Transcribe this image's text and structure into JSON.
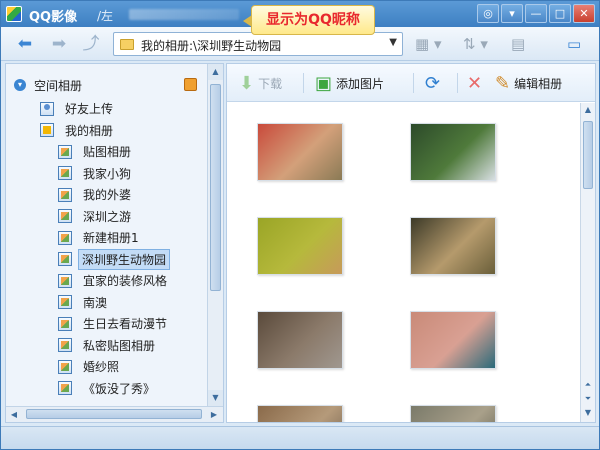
{
  "app": {
    "title": "QQ影像",
    "path_prefix": "/左"
  },
  "tooltip": "显示为QQ昵称",
  "address": {
    "value": "我的相册:\\深圳野生动物园"
  },
  "sidebar": {
    "title": "空间相册",
    "items": [
      {
        "label": "好友上传",
        "level": 1,
        "icon": "person"
      },
      {
        "label": "我的相册",
        "level": 1,
        "icon": "star"
      },
      {
        "label": "贴图相册",
        "level": 2
      },
      {
        "label": "我家小狗",
        "level": 2
      },
      {
        "label": "我的外婆",
        "level": 2
      },
      {
        "label": "深圳之游",
        "level": 2
      },
      {
        "label": "新建相册1",
        "level": 2
      },
      {
        "label": "深圳野生动物园",
        "level": 2,
        "selected": true
      },
      {
        "label": "宜家的装修风格",
        "level": 2
      },
      {
        "label": "南澳",
        "level": 2
      },
      {
        "label": "生日去看动漫节",
        "level": 2
      },
      {
        "label": "私密贴图相册",
        "level": 2
      },
      {
        "label": "婚纱照",
        "level": 2
      },
      {
        "label": "《饭没了秀》",
        "level": 2
      }
    ]
  },
  "toolbar": {
    "download": "下载",
    "add_picture": "添加图片",
    "edit_album": "编辑相册"
  },
  "photos": [
    {
      "name": "red-enclosure",
      "colors": [
        "#c94a3b",
        "#d3a07a",
        "#8a7a55"
      ]
    },
    {
      "name": "white-goat-fence",
      "colors": [
        "#2c4a2a",
        "#4f7a3b",
        "#d8dfe2"
      ]
    },
    {
      "name": "swimming-animal",
      "colors": [
        "#9aa526",
        "#b6b93c",
        "#c79a5a"
      ]
    },
    {
      "name": "antelope-pen",
      "colors": [
        "#3c3a28",
        "#b59a6c",
        "#6a5f3a"
      ]
    },
    {
      "name": "horse-road",
      "colors": [
        "#5a4a3b",
        "#8b7a6a",
        "#a09890"
      ]
    },
    {
      "name": "peacock-ground",
      "colors": [
        "#c98a78",
        "#d9a093",
        "#2a6a7a"
      ]
    },
    {
      "name": "row3-left",
      "colors": [
        "#8a6a4a",
        "#b59a7a",
        "#6a5a4a"
      ]
    },
    {
      "name": "row3-right",
      "colors": [
        "#7a7a6a",
        "#a9a08a",
        "#5a5a4a"
      ]
    }
  ],
  "icons": {
    "back": "back-arrow-icon",
    "forward": "forward-arrow-icon",
    "up": "up-folder-icon"
  }
}
